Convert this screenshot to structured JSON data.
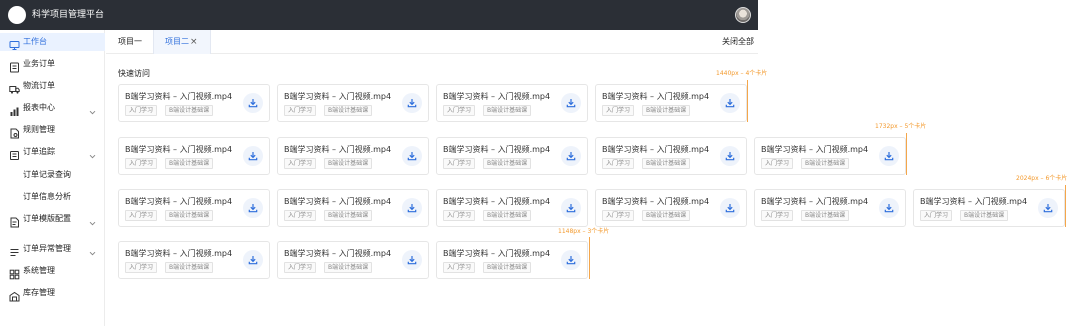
{
  "app": {
    "title": "科学项目管理平台"
  },
  "colors": {
    "accent": "#2f6fdc",
    "topbar": "#2b2f36",
    "annotation": "#f39a2e"
  },
  "sidebar": {
    "items": [
      {
        "label": "工作台",
        "icon": "monitor-icon",
        "active": true
      },
      {
        "label": "业务订单",
        "icon": "document-icon"
      },
      {
        "label": "物流订单",
        "icon": "truck-icon"
      },
      {
        "label": "报表中心",
        "icon": "bar-chart-icon",
        "expandable": true
      },
      {
        "label": "规则管理",
        "icon": "file-icon"
      },
      {
        "label": "订单追踪",
        "icon": "list-icon",
        "expandable": true
      },
      {
        "label": "订单记录查询",
        "sub": true
      },
      {
        "label": "订单信息分析",
        "sub": true
      },
      {
        "label": "订单模版配置",
        "icon": "template-icon",
        "expandable": true
      },
      {
        "label": "订单异常管理",
        "icon": "alert-list-icon",
        "expandable": true
      },
      {
        "label": "系统管理",
        "icon": "grid-icon"
      },
      {
        "label": "库存管理",
        "icon": "warehouse-icon"
      }
    ]
  },
  "tabs": [
    {
      "label": "项目一"
    },
    {
      "label": "项目二",
      "active": true,
      "close": "×"
    }
  ],
  "close_all": "关闭全部",
  "quick_access": {
    "title": "快速访问",
    "card": {
      "title": "B端学习资料 – 入门视频.mp4",
      "tags": [
        "入门学习",
        "B端设计基础课"
      ],
      "action_icon": "download-icon"
    },
    "rows": [
      4,
      5,
      6,
      3
    ]
  },
  "annotations": [
    {
      "label": "1440px – 4个卡片"
    },
    {
      "label": "1732px – 5个卡片"
    },
    {
      "label": "2024px – 6个卡片"
    },
    {
      "label": "1148px – 3个卡片"
    }
  ]
}
